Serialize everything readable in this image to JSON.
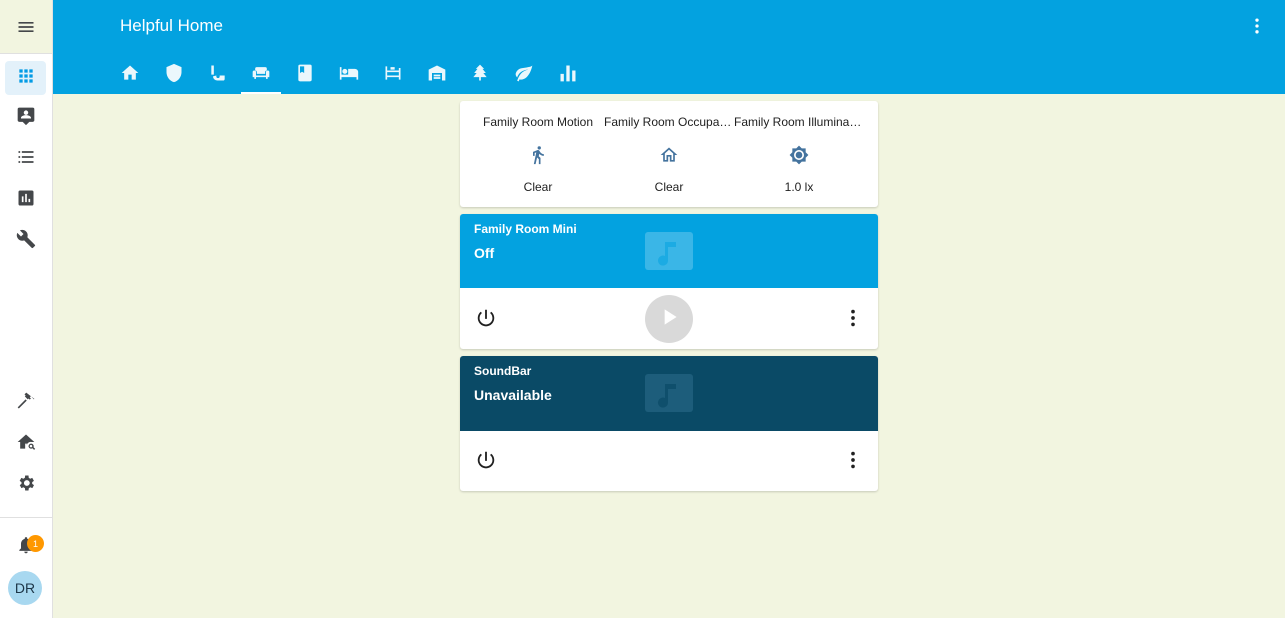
{
  "app": {
    "title": "Helpful Home"
  },
  "sidebar": {
    "items": [
      {
        "icon": "menu-icon"
      },
      {
        "icon": "view-dashboard-icon",
        "active": true
      },
      {
        "icon": "map-account-icon"
      },
      {
        "icon": "format-list-bulleted-icon"
      },
      {
        "icon": "chart-box-icon"
      },
      {
        "icon": "wrench-icon"
      },
      {
        "icon": "hammer-icon"
      },
      {
        "icon": "home-search-icon"
      },
      {
        "icon": "cog-icon"
      },
      {
        "icon": "bell-icon"
      }
    ],
    "notification_count": "1",
    "avatar_initials": "DR"
  },
  "tabs": [
    {
      "icon": "home-icon"
    },
    {
      "icon": "shield-icon"
    },
    {
      "icon": "kitchen-icon"
    },
    {
      "icon": "sofa-icon",
      "active": true
    },
    {
      "icon": "book-icon"
    },
    {
      "icon": "bed-icon"
    },
    {
      "icon": "bed-small-icon"
    },
    {
      "icon": "garage-icon"
    },
    {
      "icon": "tree-icon"
    },
    {
      "icon": "leaf-icon"
    },
    {
      "icon": "chart-bar-icon"
    }
  ],
  "glance": [
    {
      "name": "Family Room Motion",
      "state": "Clear",
      "icon": "walk-icon"
    },
    {
      "name": "Family Room Occupancy",
      "state": "Clear",
      "icon": "home-outline-icon"
    },
    {
      "name": "Family Room Illuminance",
      "state": "1.0 lx",
      "icon": "brightness-icon"
    }
  ],
  "media": [
    {
      "name": "Family Room Mini",
      "state": "Off",
      "color": "#03a2e0"
    },
    {
      "name": "SoundBar",
      "state": "Unavailable",
      "color": "#0a4a66"
    }
  ],
  "colors": {
    "primary": "#03a2e0",
    "background": "#f2f5e0",
    "accent": "#ff9800"
  }
}
